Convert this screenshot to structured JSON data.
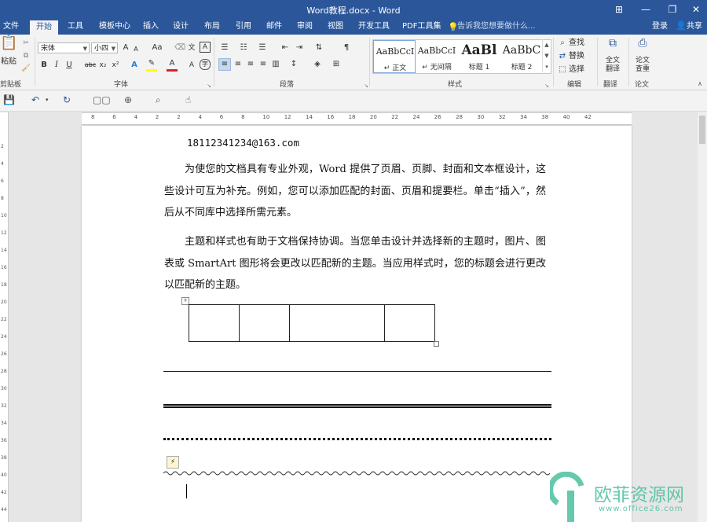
{
  "window": {
    "title": "Word教程.docx - Word",
    "controls": {
      "ribbon_display": "⊞",
      "minimize": "—",
      "restore": "❐",
      "close": "✕"
    }
  },
  "tabs": [
    {
      "label": "文件"
    },
    {
      "label": "开始",
      "active": true
    },
    {
      "label": "工具"
    },
    {
      "label": "模板中心"
    },
    {
      "label": "插入"
    },
    {
      "label": "设计"
    },
    {
      "label": "布局"
    },
    {
      "label": "引用"
    },
    {
      "label": "邮件"
    },
    {
      "label": "审阅"
    },
    {
      "label": "视图"
    },
    {
      "label": "开发工具"
    },
    {
      "label": "PDF工具集"
    }
  ],
  "tell_me": "告诉我您想要做什么...",
  "account": {
    "login": "登录",
    "share": "共享"
  },
  "ribbon": {
    "clipboard": {
      "paste": "粘贴",
      "label": "剪贴板"
    },
    "font": {
      "font_name": "宋体",
      "font_size": "小四",
      "bold": "B",
      "italic": "I",
      "underline": "U",
      "strike": "abc",
      "subscript": "x₂",
      "superscript": "x²",
      "change_case": "Aa",
      "grow": "A",
      "shrink": "A",
      "pinyin": "文",
      "border_char": "A",
      "label": "字体"
    },
    "paragraph": {
      "label": "段落"
    },
    "styles": {
      "items": [
        {
          "sample": "AaBbCcI",
          "name": "↵ 正文"
        },
        {
          "sample": "AaBbCcI",
          "name": "↵ 无间隔"
        },
        {
          "sample": "AaBl",
          "name": "标题 1"
        },
        {
          "sample": "AaBbC",
          "name": "标题 2"
        }
      ],
      "label": "样式"
    },
    "editing": {
      "find": "查找",
      "replace": "替换",
      "select": "选择",
      "label": "编辑"
    },
    "translate": {
      "full_text": "全文",
      "translate": "翻译",
      "label": "翻译"
    },
    "paper": {
      "line1": "论文",
      "line2": "查重",
      "label": "论文"
    }
  },
  "ruler": {
    "ticks": [
      "8",
      "6",
      "4",
      "2",
      "2",
      "4",
      "6",
      "8",
      "10",
      "12",
      "14",
      "16",
      "18",
      "20",
      "22",
      "24",
      "26",
      "28",
      "30",
      "32",
      "34",
      "38",
      "40",
      "42"
    ]
  },
  "vruler_ticks": [
    "2",
    "4",
    "6",
    "8",
    "10",
    "12",
    "14",
    "16",
    "18",
    "20",
    "22",
    "24",
    "26",
    "28",
    "30",
    "32",
    "34",
    "36",
    "38",
    "40",
    "42",
    "44"
  ],
  "document": {
    "email": "18112341234@163.com",
    "paragraph1": "为使您的文档具有专业外观，Word 提供了页眉、页脚、封面和文本框设计，这些设计可互为补充。例如，您可以添加匹配的封面、页眉和提要栏。单击“插入”，然后从不同库中选择所需元素。",
    "paragraph2": "主题和样式也有助于文档保持协调。当您单击设计并选择新的主题时，图片、图表或 SmartArt 图形将会更改以匹配新的主题。当应用样式时，您的标题会进行更改以匹配新的主题。",
    "table": {
      "rows": 1,
      "cols": 4,
      "cells": [
        "",
        "",
        "",
        ""
      ]
    }
  },
  "watermark": {
    "brand": "欧菲资源网",
    "url": "www.office26.com",
    "color": "#4bbf9f"
  },
  "colors": {
    "accent": "#2b579a",
    "highlight": "#ffff00",
    "font_color": "#e02020"
  }
}
